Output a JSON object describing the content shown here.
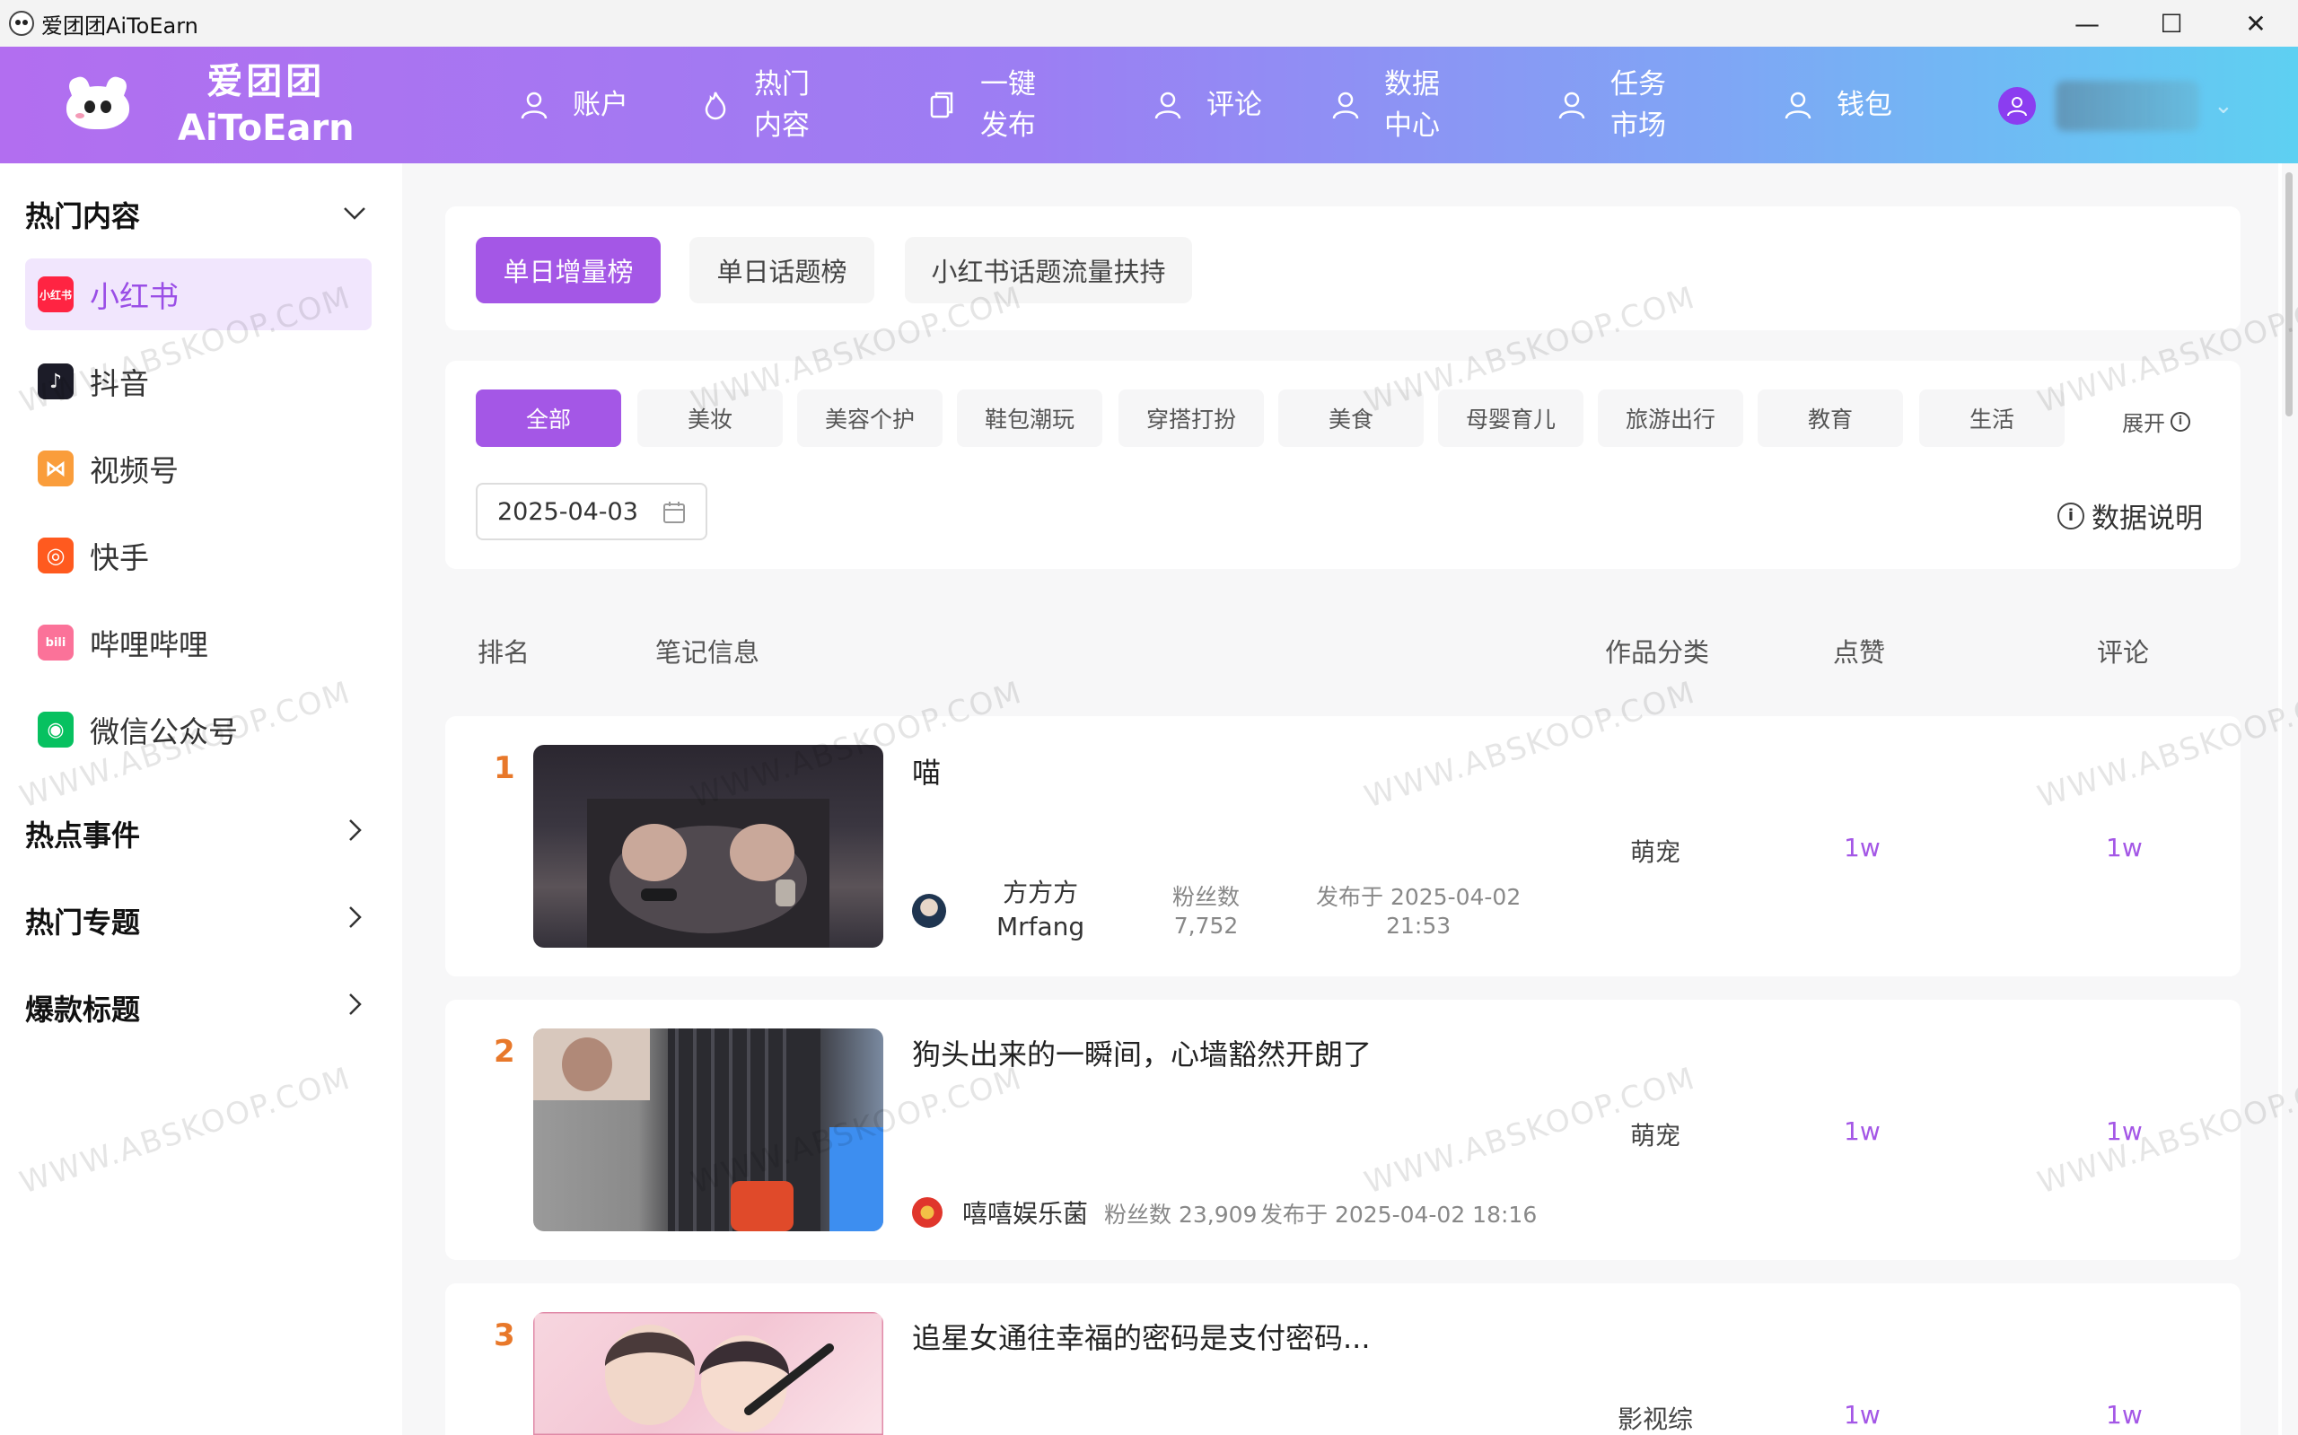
{
  "window": {
    "title": "爱团团AiToEarn",
    "controls": [
      "—",
      "☐",
      "✕"
    ]
  },
  "header": {
    "logo_cn": "爱团团",
    "logo_en": "AiToEarn",
    "nav": [
      {
        "label": "账户",
        "icon": "user-icon"
      },
      {
        "label": "热门内容",
        "icon": "flame-icon"
      },
      {
        "label": "一键发布",
        "icon": "copy-icon"
      },
      {
        "label": "评论",
        "icon": "user-icon"
      },
      {
        "label": "数据中心",
        "icon": "user-icon"
      },
      {
        "label": "任务市场",
        "icon": "user-icon"
      },
      {
        "label": "钱包",
        "icon": "user-icon"
      }
    ],
    "user_chevron": "⌄"
  },
  "sidebar": {
    "sections": [
      {
        "label": "热门内容",
        "expanded": true
      },
      {
        "label": "热点事件",
        "expanded": false
      },
      {
        "label": "热门专题",
        "expanded": false
      },
      {
        "label": "爆款标题",
        "expanded": false
      }
    ],
    "platforms": [
      {
        "label": "小红书",
        "icon": "xiaohongshu-icon",
        "icon_text": "小红书",
        "color": "#ff2442",
        "active": true
      },
      {
        "label": "抖音",
        "icon": "douyin-icon",
        "icon_text": "♪",
        "color": "#1c1c28",
        "active": false
      },
      {
        "label": "视频号",
        "icon": "shipinhao-icon",
        "icon_text": "⋈",
        "color": "#fa9d3b",
        "active": false
      },
      {
        "label": "快手",
        "icon": "kuaishou-icon",
        "icon_text": "◎",
        "color": "#ff5a1f",
        "active": false
      },
      {
        "label": "哔哩哔哩",
        "icon": "bilibili-icon",
        "icon_text": "bili",
        "color": "#fb7299",
        "active": false
      },
      {
        "label": "微信公众号",
        "icon": "wechat-icon",
        "icon_text": "◉",
        "color": "#07c160",
        "active": false
      }
    ]
  },
  "tabs": [
    {
      "label": "单日增量榜",
      "active": true
    },
    {
      "label": "单日话题榜",
      "active": false
    },
    {
      "label": "小红书话题流量扶持",
      "active": false
    }
  ],
  "categories": [
    {
      "label": "全部",
      "active": true
    },
    {
      "label": "美妆",
      "active": false
    },
    {
      "label": "美容个护",
      "active": false
    },
    {
      "label": "鞋包潮玩",
      "active": false
    },
    {
      "label": "穿搭打扮",
      "active": false
    },
    {
      "label": "美食",
      "active": false
    },
    {
      "label": "母婴育儿",
      "active": false
    },
    {
      "label": "旅游出行",
      "active": false
    },
    {
      "label": "教育",
      "active": false
    },
    {
      "label": "生活",
      "active": false
    }
  ],
  "expand_label": "展开",
  "date_value": "2025-04-03",
  "data_note": "数据说明",
  "table_headers": {
    "rank": "排名",
    "info": "笔记信息",
    "category": "作品分类",
    "likes": "点赞",
    "comments": "评论"
  },
  "rows": [
    {
      "rank": "1",
      "title": "喵",
      "author_line1": "方方方",
      "author_line2": "Mrfang",
      "fans_label": "粉丝数",
      "fans": "7,752",
      "published_line1": "发布于 2025-04-02",
      "published_line2": "21:53",
      "category": "萌宠",
      "likes": "1w",
      "comments": "1w"
    },
    {
      "rank": "2",
      "title": "狗头出来的一瞬间，心墙豁然开朗了",
      "author": "嘻嘻娱乐菌",
      "fans_text": "粉丝数 23,909",
      "published": "发布于 2025-04-02 18:16",
      "category": "萌宠",
      "likes": "1w",
      "comments": "1w"
    },
    {
      "rank": "3",
      "title": "追星女通往幸福的密码是支付密码...",
      "category": "影视综",
      "likes": "1w",
      "comments": "1w"
    }
  ],
  "watermark": "WWW.ABSKOOP.COM",
  "colors": {
    "accent": "#a457e6",
    "rank": "#e8782a",
    "header_start": "#b26ef0",
    "header_end": "#5ed0f2"
  }
}
